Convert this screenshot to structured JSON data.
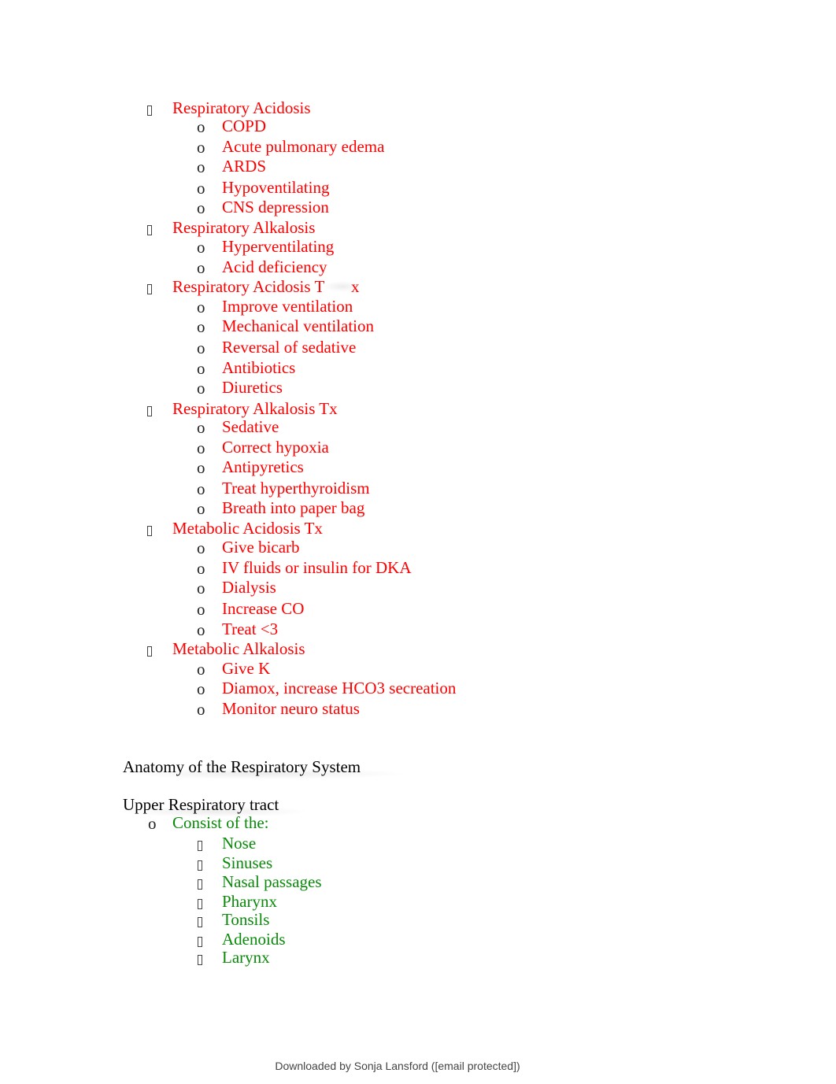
{
  "document": {
    "sections": [
      {
        "heading": "Respiratory Acidosis",
        "items": [
          "COPD",
          "Acute pulmonary edema",
          "ARDS",
          "Hypoventilating",
          "CNS depression"
        ]
      },
      {
        "heading": "Respiratory Alkalosis",
        "items": [
          "Hyperventilating",
          "Acid deficiency"
        ]
      },
      {
        "heading_prefix": "Respiratory Acidosis T",
        "heading_suffix": "x",
        "items": [
          "Improve ventilation",
          "Mechanical ventilation",
          "Reversal of sedative",
          "Antibiotics",
          "Diuretics"
        ]
      },
      {
        "heading": "Respiratory Alkalosis Tx",
        "items": [
          "Sedative",
          "Correct hypoxia",
          "Antipyretics",
          "Treat hyperthyroidism",
          "Breath into paper bag"
        ]
      },
      {
        "heading": "Metabolic Acidosis Tx",
        "items": [
          "Give bicarb",
          "IV fluids or insulin for DKA",
          "Dialysis",
          "Increase CO",
          "Treat <3"
        ]
      },
      {
        "heading": "Metabolic Alkalosis",
        "items": [
          "Give K",
          "Diamox, increase HCO3 secreation",
          "Monitor neuro status"
        ]
      }
    ],
    "anatomy_heading": "Anatomy of the Respiratory System",
    "upper_tract_heading": "Upper Respiratory tract",
    "upper_tract_sub": "Consist of the:",
    "upper_tract_items": [
      "Nose",
      "Sinuses",
      "Nasal passages",
      "Pharynx",
      "Tonsils",
      "Adenoids",
      "Larynx"
    ],
    "sub_bullet_glyph": "o",
    "colors": {
      "primary_text": "#ff0000",
      "secondary_text": "#0a8a0a",
      "heading_text": "#000000"
    }
  },
  "footer": {
    "text": "Downloaded by Sonja Lansford ([email protected])"
  }
}
